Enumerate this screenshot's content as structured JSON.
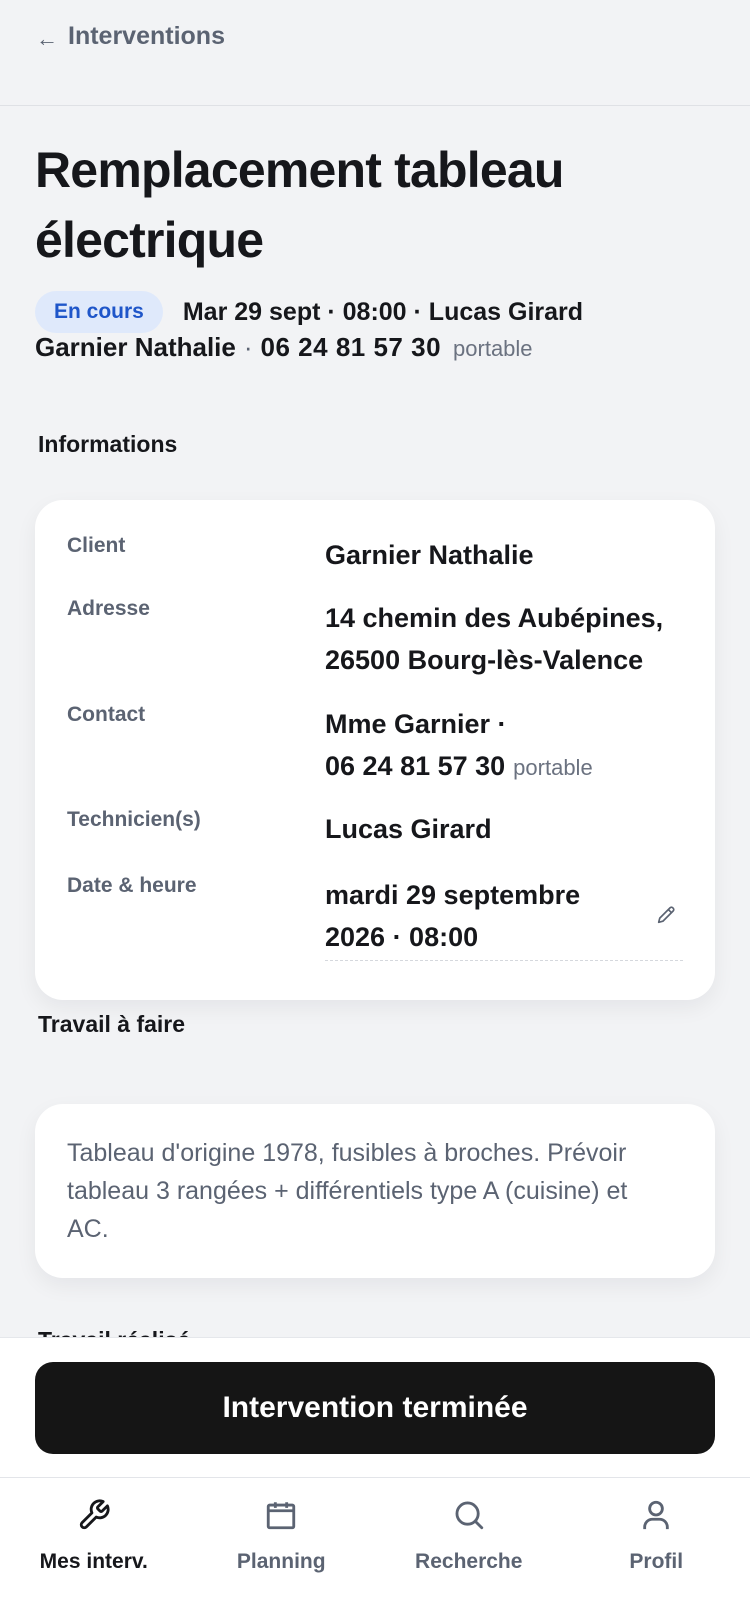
{
  "header": {
    "back_label": "Interventions"
  },
  "intervention": {
    "title": "Remplacement tableau électrique",
    "status": "En cours",
    "summary": "Mar 29 sept · 08:00 · Lucas Girard",
    "client_name": "Garnier Nathalie",
    "separator": "·",
    "phone": "06 24 81 57 30",
    "phone_type": "portable"
  },
  "informations": {
    "section_title": "Informations",
    "rows": [
      {
        "label": "Client",
        "value": "Garnier Nathalie"
      },
      {
        "label": "Adresse",
        "value": "14 chemin des Aubépines, 26500 Bourg-lès-Valence"
      },
      {
        "label": "Contact",
        "value": "Mme Garnier ·",
        "phone": "06 24 81 57 30",
        "phone_type": "portable"
      },
      {
        "label": "Technicien(s)",
        "value": "Lucas Girard"
      },
      {
        "label": "Date & heure",
        "value": "mardi 29 septembre 2026 · 08:00"
      }
    ]
  },
  "travail": {
    "section_title": "Travail à faire",
    "text": "Tableau d'origine 1978, fusibles à broches. Prévoir tableau 3 rangées + différentiels type A (cuisine) et AC.",
    "next_section_title": "Travail réalisé"
  },
  "actions": {
    "finish_label": "Intervention terminée"
  },
  "nav": {
    "items": [
      {
        "label": "Mes interv.",
        "icon": "wrench-icon",
        "active": true
      },
      {
        "label": "Planning",
        "icon": "calendar-icon",
        "active": false
      },
      {
        "label": "Recherche",
        "icon": "search-icon",
        "active": false
      },
      {
        "label": "Profil",
        "icon": "user-icon",
        "active": false
      }
    ]
  },
  "colors": {
    "background": "#f2f3f5",
    "badge_bg": "#dfe9fb",
    "badge_text": "#1f56c9",
    "primary_button": "#151515",
    "muted_text": "#5b6372"
  }
}
